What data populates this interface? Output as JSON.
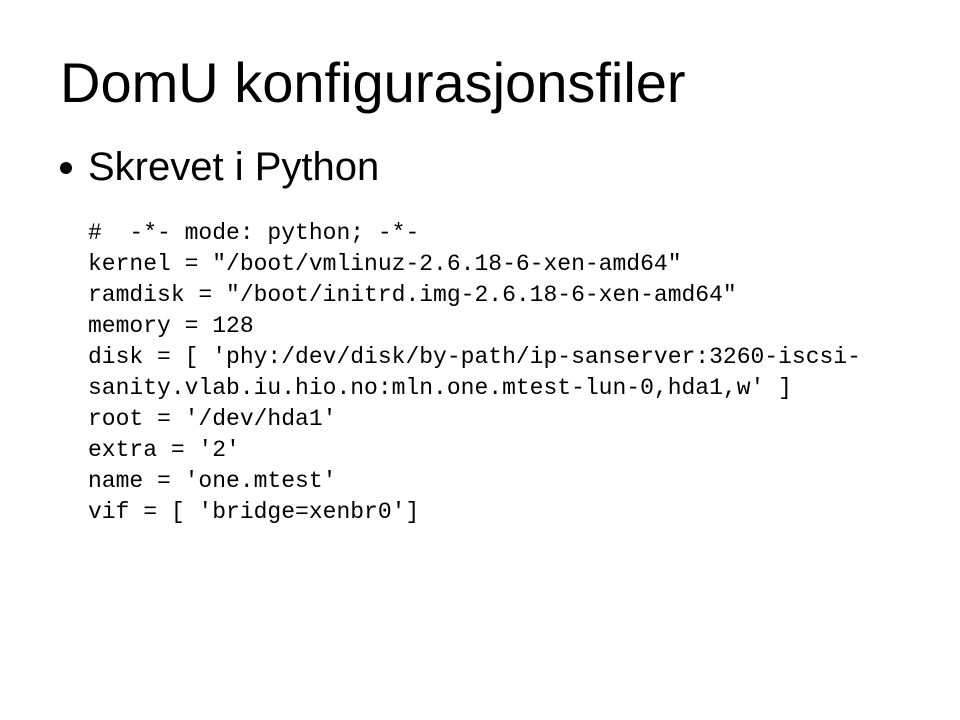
{
  "title": "DomU konfigurasjonsfiler",
  "bullet": "Skrevet i Python",
  "code": {
    "l1": "#  -*- mode: python; -*-",
    "l2": "kernel = \"/boot/vmlinuz-2.6.18-6-xen-amd64\"",
    "l3": "ramdisk = \"/boot/initrd.img-2.6.18-6-xen-amd64\"",
    "l4": "memory = 128",
    "l5": "disk = [ 'phy:/dev/disk/by-path/ip-sanserver:3260-iscsi-",
    "l6": "sanity.vlab.iu.hio.no:mln.one.mtest-lun-0,hda1,w' ]",
    "l7": "root = '/dev/hda1'",
    "l8": "extra = '2'",
    "l9": "name = 'one.mtest'",
    "l10": "vif = [ 'bridge=xenbr0']"
  }
}
